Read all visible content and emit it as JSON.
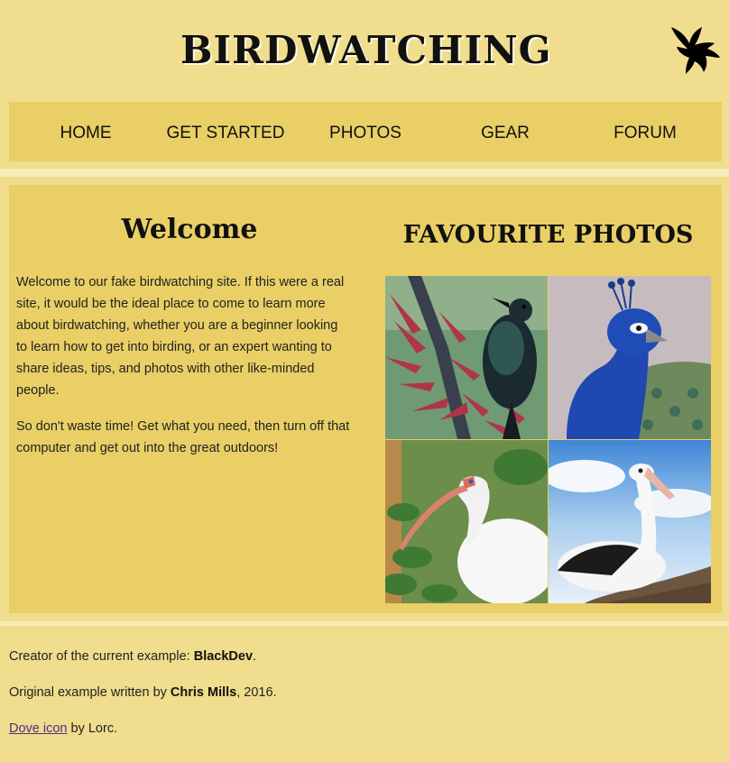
{
  "header": {
    "site_title": "BIRDWATCHING",
    "logo_icon": "dove-icon"
  },
  "nav": {
    "items": [
      {
        "label": "HOME"
      },
      {
        "label": "GET STARTED"
      },
      {
        "label": "PHOTOS"
      },
      {
        "label": "GEAR"
      },
      {
        "label": "FORUM"
      }
    ]
  },
  "main": {
    "welcome_heading": "Welcome",
    "welcome_paragraphs": [
      "Welcome to our fake birdwatching site. If this were a real site, it would be the ideal place to come to learn more about birdwatching, whether you are a beginner looking to learn how to get into birding, or an expert wanting to share ideas, tips, and photos with other like-minded people.",
      "So don't waste time! Get what you need, then turn off that computer and get out into the great outdoors!"
    ],
    "photos_heading": "FAVOURITE PHOTOS",
    "photos": [
      {
        "subject": "tui-bird-photo"
      },
      {
        "subject": "peacock-photo"
      },
      {
        "subject": "ibis-photo"
      },
      {
        "subject": "pelican-photo"
      }
    ]
  },
  "footer": {
    "creator_prefix": "Creator of the current example: ",
    "creator_name": "BlackDev",
    "creator_suffix": ".",
    "original_prefix": "Original example written by ",
    "original_author": "Chris Mills",
    "original_suffix": ", 2016.",
    "icon_link": "Dove icon",
    "icon_credit": " by Lorc."
  },
  "colors": {
    "background": "#f0dd8d",
    "panel": "#e9cf66",
    "divider": "#f7ebb8",
    "link": "#5b2a86"
  }
}
